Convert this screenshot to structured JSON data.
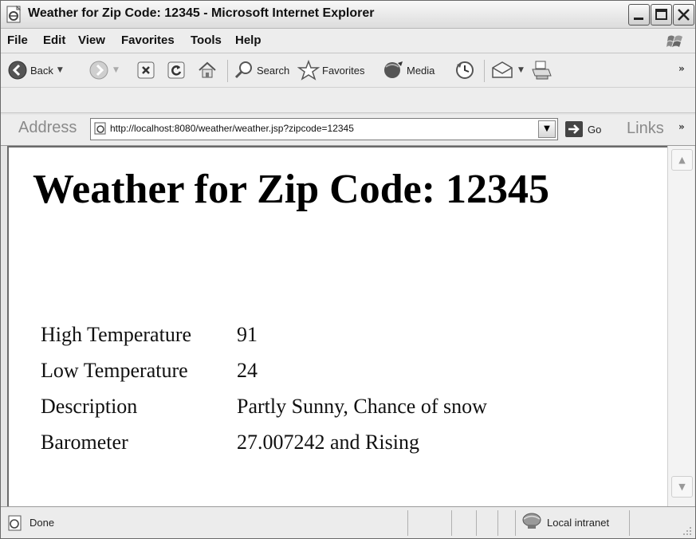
{
  "window": {
    "title": "Weather for Zip Code: 12345 - Microsoft Internet Explorer",
    "controls": [
      "minimize",
      "maximize",
      "close"
    ]
  },
  "menu": [
    "File",
    "Edit",
    "View",
    "Favorites",
    "Tools",
    "Help"
  ],
  "toolbar": {
    "back_label": "Back",
    "search_label": "Search",
    "favorites_label": "Favorites",
    "media_label": "Media",
    "overflow": "»"
  },
  "address": {
    "label": "Address",
    "url": "http://localhost:8080/weather/weather.jsp?zipcode=12345",
    "go_label": "Go",
    "links_label": "Links",
    "overflow": "»"
  },
  "page": {
    "title": "Weather for Zip Code: 12345",
    "rows": [
      {
        "label": "High Temperature",
        "value": "91"
      },
      {
        "label": "Low Temperature",
        "value": "24"
      },
      {
        "label": "Description",
        "value": "Partly Sunny, Chance of snow"
      },
      {
        "label": "Barometer",
        "value": "27.007242 and Rising"
      }
    ]
  },
  "status": {
    "text": "Done",
    "zone": "Local intranet"
  }
}
